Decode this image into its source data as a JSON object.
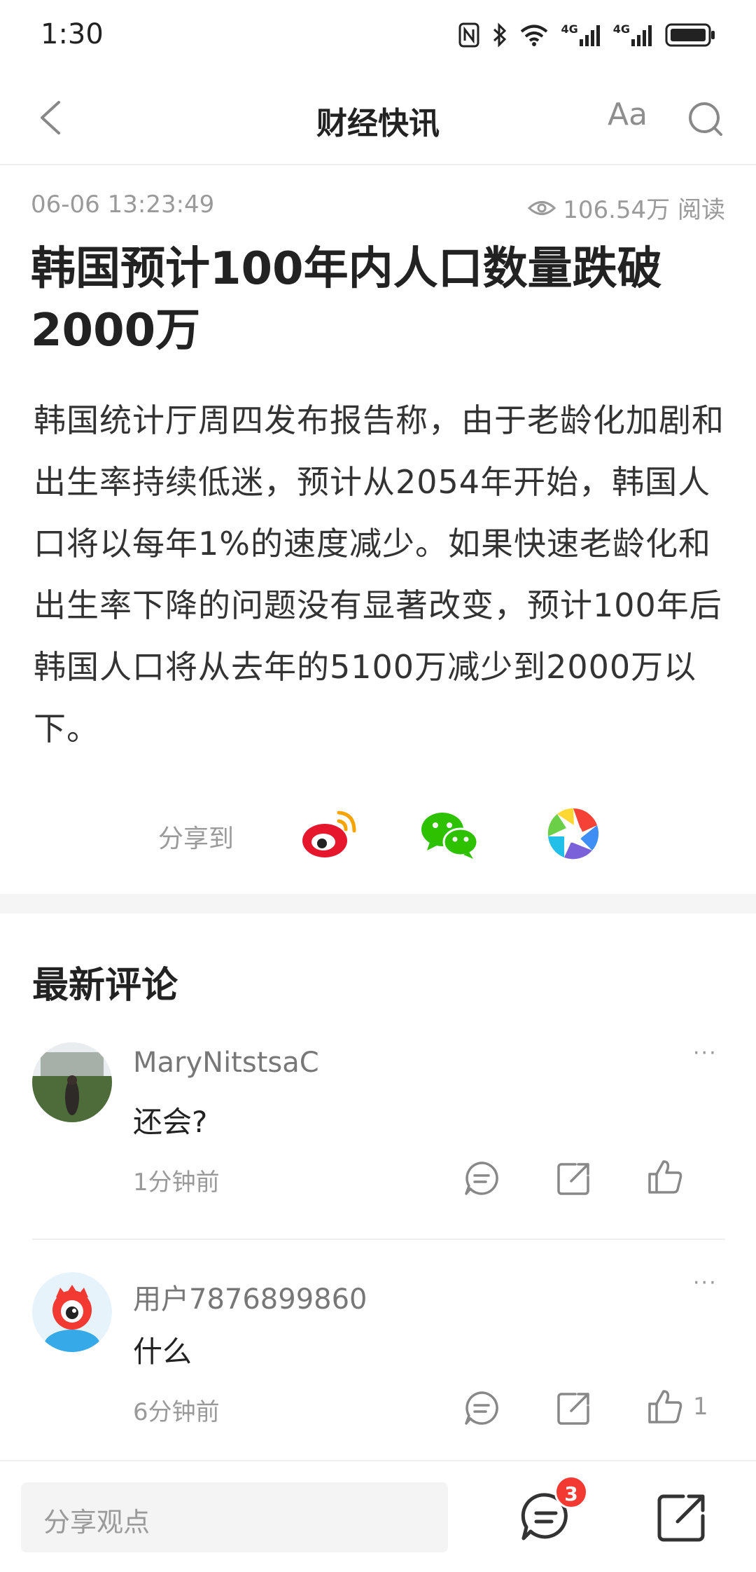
{
  "status_bar": {
    "time": "1:30",
    "signal_label_1": "4G",
    "signal_label_2": "4G"
  },
  "nav": {
    "title": "财经快讯",
    "font_label": "Aa",
    "back_icon": "chevron-left-icon",
    "search_icon": "search-icon"
  },
  "article": {
    "timestamp": "06-06 13:23:49",
    "views": "106.54万 阅读",
    "headline": "韩国预计100年内人口数量跌破2000万",
    "body": "韩国统计厅周四发布报告称，由于老龄化加剧和出生率持续低迷，预计从2054年开始，韩国人口将以每年1%的速度减少。如果快速老龄化和出生率下降的问题没有显著改变，预计100年后韩国人口将从去年的5100万减少到2000万以下。"
  },
  "share": {
    "label": "分享到",
    "targets": [
      "weibo-icon",
      "wechat-icon",
      "moments-icon"
    ]
  },
  "comments": {
    "heading": "最新评论",
    "items": [
      {
        "user": "MaryNitstsaC",
        "text": "还会?",
        "time": "1分钟前",
        "likes": ""
      },
      {
        "user": "用户7876899860",
        "text": "什么",
        "time": "6分钟前",
        "likes": "1"
      }
    ],
    "more_label": "···"
  },
  "bottom_bar": {
    "input_placeholder": "分享观点",
    "comment_count": "3"
  },
  "colors": {
    "accent_red": "#f23a32",
    "weibo_red": "#e6162d",
    "wechat_green": "#2dc100",
    "muted_text": "#9a9a9a"
  }
}
